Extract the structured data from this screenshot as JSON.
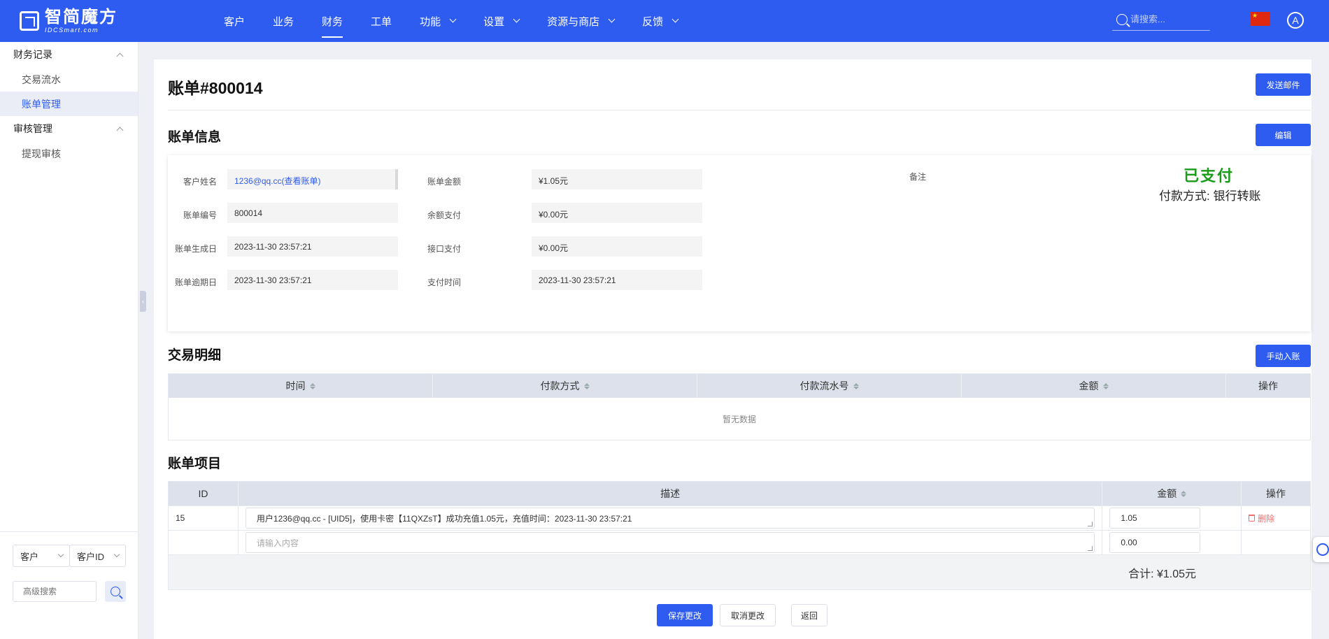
{
  "brand": {
    "name": "智简魔方",
    "sub": "IDCSmart.com"
  },
  "nav": [
    {
      "label": "客户",
      "dropdown": false,
      "active": false
    },
    {
      "label": "业务",
      "dropdown": false,
      "active": false
    },
    {
      "label": "财务",
      "dropdown": false,
      "active": true
    },
    {
      "label": "工单",
      "dropdown": false,
      "active": false
    },
    {
      "label": "功能",
      "dropdown": true,
      "active": false
    },
    {
      "label": "设置",
      "dropdown": true,
      "active": false
    },
    {
      "label": "资源与商店",
      "dropdown": true,
      "active": false
    },
    {
      "label": "反馈",
      "dropdown": true,
      "active": false
    }
  ],
  "search": {
    "placeholder": "请搜索..."
  },
  "avatar": {
    "letter": "A"
  },
  "sidebar": {
    "groups": [
      {
        "title": "财务记录",
        "items": [
          {
            "label": "交易流水",
            "active": false
          },
          {
            "label": "账单管理",
            "active": true
          }
        ]
      },
      {
        "title": "审核管理",
        "items": [
          {
            "label": "提现审核",
            "active": false
          }
        ]
      }
    ],
    "filter": {
      "type": "客户",
      "field": "客户ID",
      "adv_placeholder": "高级搜索"
    }
  },
  "page": {
    "title": "账单#800014",
    "send_email": "发送邮件"
  },
  "info": {
    "title": "账单信息",
    "edit": "编辑",
    "left": [
      {
        "label": "客户姓名",
        "value": "1236@qq.cc(查看账单)"
      },
      {
        "label": "账单编号",
        "value": "800014"
      },
      {
        "label": "账单生成日",
        "value": "2023-11-30 23:57:21"
      },
      {
        "label": "账单逾期日",
        "value": "2023-11-30 23:57:21"
      }
    ],
    "mid": [
      {
        "label": "账单金额",
        "value": "¥1.05元"
      },
      {
        "label": "余额支付",
        "value": "¥0.00元"
      },
      {
        "label": "接口支付",
        "value": "¥0.00元"
      },
      {
        "label": "支付时间",
        "value": "2023-11-30 23:57:21"
      }
    ],
    "note_label": "备注",
    "status": "已支付",
    "pay_method": "付款方式: 银行转账",
    "status_color": "#1a9b1a"
  },
  "transactions": {
    "title": "交易明细",
    "add": "手动入账",
    "columns": [
      "时间",
      "付款方式",
      "付款流水号",
      "金额",
      "操作"
    ],
    "empty": "暂无数据"
  },
  "items": {
    "title": "账单项目",
    "columns": [
      "ID",
      "描述",
      "金额",
      "操作"
    ],
    "rows": [
      {
        "id": "15",
        "desc": "用户1236@qq.cc - [UID5]，使用卡密【11QXZsT】成功充值1.05元，充值时间：2023-11-30 23:57:21",
        "amount": "1.05",
        "action": "删除"
      }
    ],
    "new_row": {
      "desc_placeholder": "请输入内容",
      "amount": "0.00"
    },
    "total": "合计: ¥1.05元"
  },
  "actions": {
    "save": "保存更改",
    "cancel": "取消更改",
    "back": "返回"
  },
  "colors": {
    "primary": "#2f5cf0",
    "danger": "#f56c6c"
  }
}
